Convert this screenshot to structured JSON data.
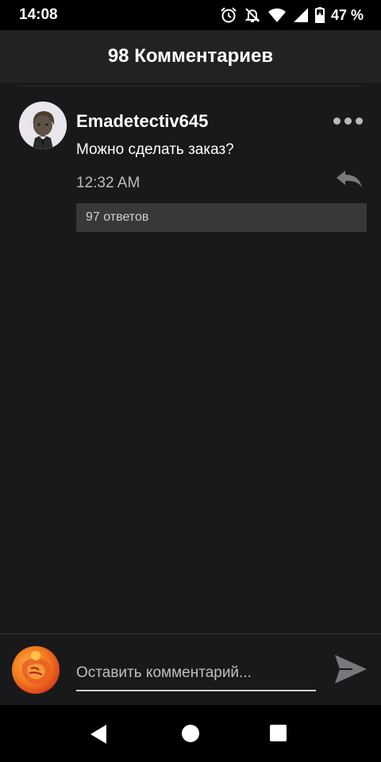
{
  "status_bar": {
    "time": "14:08",
    "battery_percent": "47 %",
    "icons": [
      "alarm-icon",
      "notifications-off-icon",
      "wifi-icon",
      "signal-icon",
      "battery-icon"
    ]
  },
  "header": {
    "title": "98 Комментариев"
  },
  "comment": {
    "username": "Emadetectiv645",
    "text": "Можно сделать заказ?",
    "time": "12:32 AM",
    "replies_label": "97 ответов"
  },
  "composer": {
    "placeholder": "Оставить комментарий..."
  },
  "colors": {
    "background": "#19181a",
    "header_bg": "#222123",
    "replies_bg": "#38373a",
    "text_muted": "#bdbcbf"
  }
}
